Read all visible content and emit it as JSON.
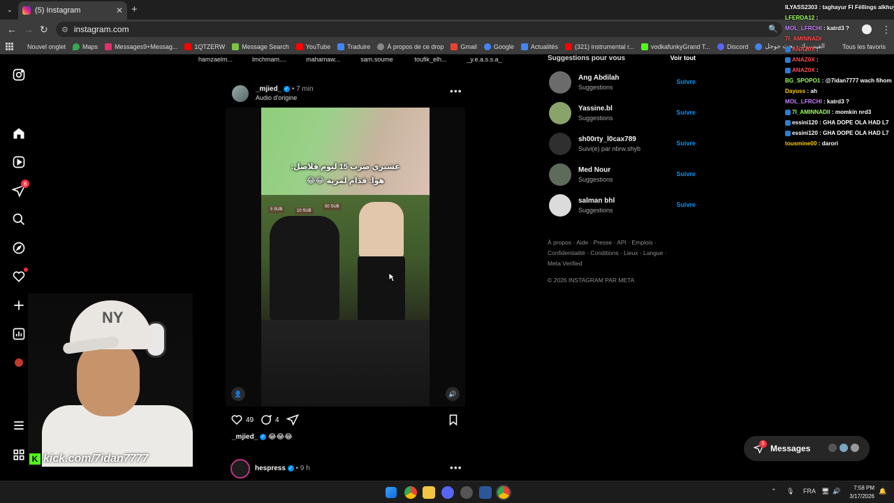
{
  "browser": {
    "tab_title": "(5) Instagram",
    "url": "instagram.com",
    "bookmarks": [
      {
        "label": "Nouvel onglet",
        "color": "#777"
      },
      {
        "label": "Maps",
        "color": "#34a853"
      },
      {
        "label": "Messages9+Messag...",
        "color": "#e1306c"
      },
      {
        "label": "1QTZERW",
        "color": "#ff0000"
      },
      {
        "label": "Message Search",
        "color": "#7cc243"
      },
      {
        "label": "YouTube",
        "color": "#ff0000"
      },
      {
        "label": "Traduire",
        "color": "#4285f4"
      },
      {
        "label": "À propos de ce drop",
        "color": "#888"
      },
      {
        "label": "Gmail",
        "color": "#ea4335"
      },
      {
        "label": "Google",
        "color": "#4285f4"
      },
      {
        "label": "Actualités",
        "color": "#4285f4"
      },
      {
        "label": "(321) instrumental r...",
        "color": "#ff0000"
      },
      {
        "label": "vodkafunkyGrand T...",
        "color": "#53fc18"
      },
      {
        "label": "Discord",
        "color": "#5865f2"
      },
      {
        "label": "الفيسبوك - بحث جوجل",
        "color": "#4285f4"
      }
    ],
    "all_bookmarks": "Tous les favoris"
  },
  "rail": {
    "messages_badge": "8"
  },
  "stories": [
    "hamzaelm...",
    "lmchmam....",
    "mahamaw...",
    "sam.soume",
    "toufik_elh...",
    "_y.e.a.s.s.a_"
  ],
  "post": {
    "username": "_mjied_",
    "time": "• 7 min",
    "audio": "Audio d'origine",
    "overlay_line1": "عشيري ضرب 15 ليوم فلاصل:",
    "overlay_line2": "هوا: قدام لمرية 😂😂",
    "sign1": "5 SUB",
    "sign2": "10 SUB",
    "sign3": "50 SUB",
    "likes": "49",
    "comments": "4",
    "caption_user": "_mjied_",
    "caption_text": "😂😂😂"
  },
  "post2": {
    "username": "hespress",
    "time": "• 9 h"
  },
  "suggestions": {
    "title": "Suggestions pour vous",
    "see_all": "Voir tout",
    "follow": "Suivre",
    "items": [
      {
        "name": "Ang Abdilah",
        "sub": "Suggestions",
        "color": "#6b6b6b"
      },
      {
        "name": "Yassine.bl",
        "sub": "Suggestions",
        "color": "#8aa36a"
      },
      {
        "name": "sh00rty_l0cax789",
        "sub": "Suivi(e) par nbrw.shyb",
        "color": "#2f2f2f"
      },
      {
        "name": "Med Nour",
        "sub": "Suggestions",
        "color": "#5e6b5a"
      },
      {
        "name": "salman bhl",
        "sub": "Suggestions",
        "color": "#dbdbdb"
      }
    ],
    "footer": "À propos · Aide · Presse · API · Emplois · Confidentialité · Conditions · Lieux · Langue · Meta Verified",
    "copyright": "© 2026 INSTAGRAM PAR META"
  },
  "chat": [
    {
      "user": "ILYASS2303",
      "msg": " : taghayur FI Fëllings alkhuy",
      "color": "#ffffff"
    },
    {
      "user": "LFERDA12",
      "msg": " : ",
      "color": "#9cff5b"
    },
    {
      "user": "MOL_LFRCHI",
      "msg": " : katrd3 ?",
      "color": "#c77dff"
    },
    {
      "user": "7I_AMINNADI",
      "msg": "",
      "color": "#ff4d4d"
    },
    {
      "user": "ANAZ0X",
      "msg": " : ",
      "color": "#ff4d4d"
    },
    {
      "user": "ANAZ0X",
      "msg": " : ",
      "color": "#ff4d4d"
    },
    {
      "user": "ANAZ0X",
      "msg": " : ",
      "color": "#ff4d4d"
    },
    {
      "user": "BG_SPOPO1",
      "msg": " : @7idan7777 wach fihom",
      "color": "#9cff5b"
    },
    {
      "user": "Dayuss",
      "msg": " : ah",
      "color": "#ffcc00"
    },
    {
      "user": "MOL_LFRCHI",
      "msg": " : katrd3 ?",
      "color": "#c77dff"
    },
    {
      "user": "7I_AMINNADII",
      "msg": " : momkin nrd3",
      "color": "#9cff5b"
    },
    {
      "user": "essini120",
      "msg": " : GHA DOPE OLA HAD L7",
      "color": "#ffffff"
    },
    {
      "user": "essini120",
      "msg": " : GHA DOPE OLA HAD L7",
      "color": "#ffffff"
    },
    {
      "user": "tousmine00",
      "msg": " : darori",
      "color": "#ffcc00"
    }
  ],
  "messages_widget": {
    "label": "Messages",
    "badge": "5"
  },
  "webcam": {
    "kick_url": "kick.com/7idan7777",
    "cap_logo": "NY"
  },
  "taskbar": {
    "lang": "FRA",
    "time": "7:58 PM",
    "date": "3/17/2026"
  }
}
